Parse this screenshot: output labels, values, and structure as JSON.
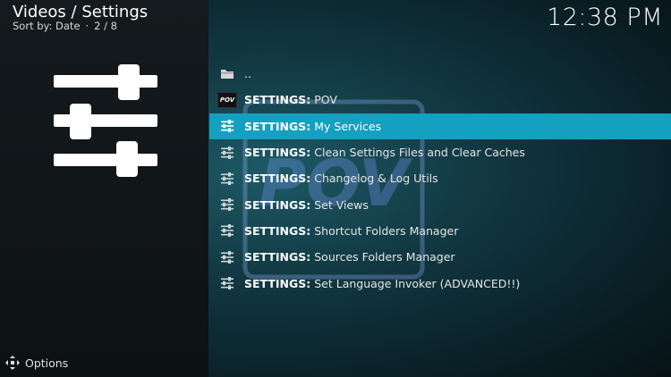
{
  "header": {
    "title": "Videos / Settings",
    "sort_label": "Sort by: Date",
    "position": "2 / 8"
  },
  "clock": "12:38 PM",
  "list": {
    "items": [
      {
        "prefix": "",
        "label": "..",
        "icon": "folder-icon"
      },
      {
        "prefix": "SETTINGS:",
        "label": " POV",
        "icon": "pov-thumbnail",
        "thumb_text": "POV"
      },
      {
        "prefix": "SETTINGS:",
        "label": " My Services",
        "icon": "sliders-icon",
        "selected": true
      },
      {
        "prefix": "SETTINGS:",
        "label": " Clean Settings Files and Clear Caches",
        "icon": "sliders-icon"
      },
      {
        "prefix": "SETTINGS:",
        "label": " Changelog & Log Utils",
        "icon": "sliders-icon"
      },
      {
        "prefix": "SETTINGS:",
        "label": " Set Views",
        "icon": "sliders-icon"
      },
      {
        "prefix": "SETTINGS:",
        "label": " Shortcut Folders Manager",
        "icon": "sliders-icon"
      },
      {
        "prefix": "SETTINGS:",
        "label": " Sources Folders Manager",
        "icon": "sliders-icon"
      },
      {
        "prefix": "SETTINGS:",
        "label": " Set Language Invoker (ADVANCED!!)",
        "icon": "sliders-icon"
      }
    ]
  },
  "watermark_text": "POV",
  "footer": {
    "options_label": "Options",
    "options_icon": "options-arrows-icon"
  },
  "colors": {
    "selection": "#14a0c0",
    "left_panel": "#121719",
    "text": "#e6e6e6"
  }
}
